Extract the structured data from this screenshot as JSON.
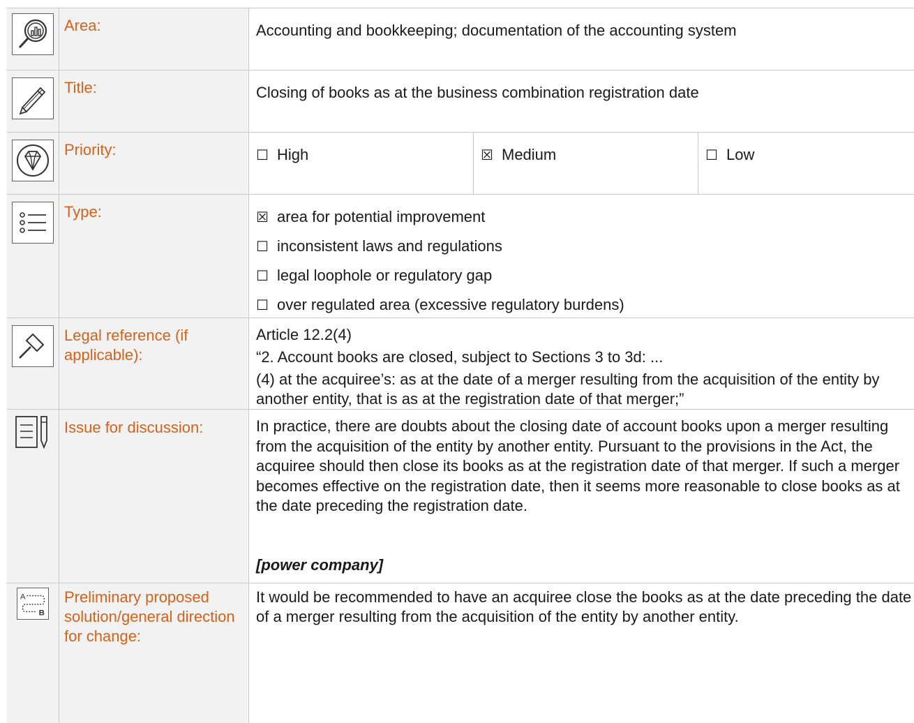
{
  "rows": {
    "area": {
      "label": "Area:",
      "value": "Accounting and bookkeeping; documentation of the accounting system"
    },
    "title": {
      "label": "Title:",
      "value": "Closing of books as at the business combination registration date"
    },
    "priority": {
      "label": "Priority:",
      "options": [
        {
          "box": "☐",
          "text": "High"
        },
        {
          "box": "☒",
          "text": "Medium"
        },
        {
          "box": "☐",
          "text": "Low"
        }
      ]
    },
    "type": {
      "label": "Type:",
      "options": [
        {
          "box": "☒",
          "text": "area for potential improvement"
        },
        {
          "box": "☐",
          "text": "inconsistent laws and regulations"
        },
        {
          "box": "☐",
          "text": "legal loophole or regulatory gap"
        },
        {
          "box": "☐",
          "text": "over regulated area (excessive regulatory burdens)"
        }
      ]
    },
    "legal": {
      "label": "Legal reference (if applicable):",
      "lines": [
        "Article 12.2(4)",
        "“2. Account books are closed, subject to Sections 3 to 3d: ...",
        "(4) at the acquiree’s: as at the date of a merger resulting from the acquisition of the entity by another entity, that is as at the registration date of that merger;”"
      ]
    },
    "issue": {
      "label": "Issue for discussion:",
      "body": "In practice, there are doubts about the closing date of account books upon a merger resulting from the acquisition of the entity by another entity. Pursuant to the provisions in the Act, the acquiree should then close its books as at the registration date of that merger. If such a merger becomes effective on the registration date, then it seems more reasonable to close books as at the date preceding the registration date.",
      "source": "[power company]"
    },
    "solution": {
      "label": "Preliminary proposed solution/general direction for change:",
      "body": "It would be recommended to have an acquiree close the books as at the date preceding the date of a merger resulting from the acquisition of the entity by another entity."
    }
  },
  "icons": [
    "magnifier-chart-icon",
    "pencil-icon",
    "diamond-icon",
    "list-icon",
    "gavel-icon",
    "document-pen-icon",
    "route-a-b-icon"
  ],
  "colors": {
    "label": "#d4621b",
    "cell_bg": "#f2f2f2",
    "border": "#c9c9c9"
  }
}
